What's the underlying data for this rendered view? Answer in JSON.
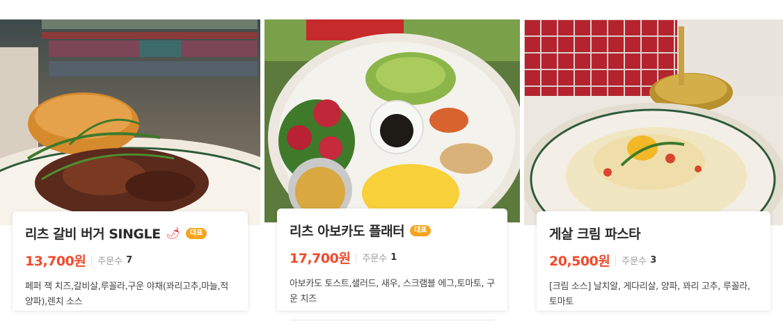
{
  "menu": [
    {
      "name": "리츠 갈비 버거 SINGLE",
      "spicy_icon": "chili-pepper-icon",
      "badge": "대표",
      "price": "13,700원",
      "order_label": "주문수",
      "order_count": "7",
      "description": "페퍼 잭 치즈,갈비살,루꼴라,구운 야채(꽈리고추,마늘,적양파),렌치 소스"
    },
    {
      "name": "리츠 아보카도 플래터",
      "badge": "대표",
      "price": "17,700원",
      "order_label": "주문수",
      "order_count": "1",
      "description": "아보카도 토스트,샐러드, 새우, 스크램블 에그,토마토, 구운 치즈"
    },
    {
      "name": "게살 크림 파스타",
      "price": "20,500원",
      "order_label": "주문수",
      "order_count": "3",
      "description": "[크림 소스] 날치알, 게다리살, 양파, 꽈리 고추, 루꼴라, 토마토"
    }
  ],
  "colors": {
    "price": "#f04a2c",
    "badge": "#f7a31c",
    "spicy": "#e53935"
  }
}
